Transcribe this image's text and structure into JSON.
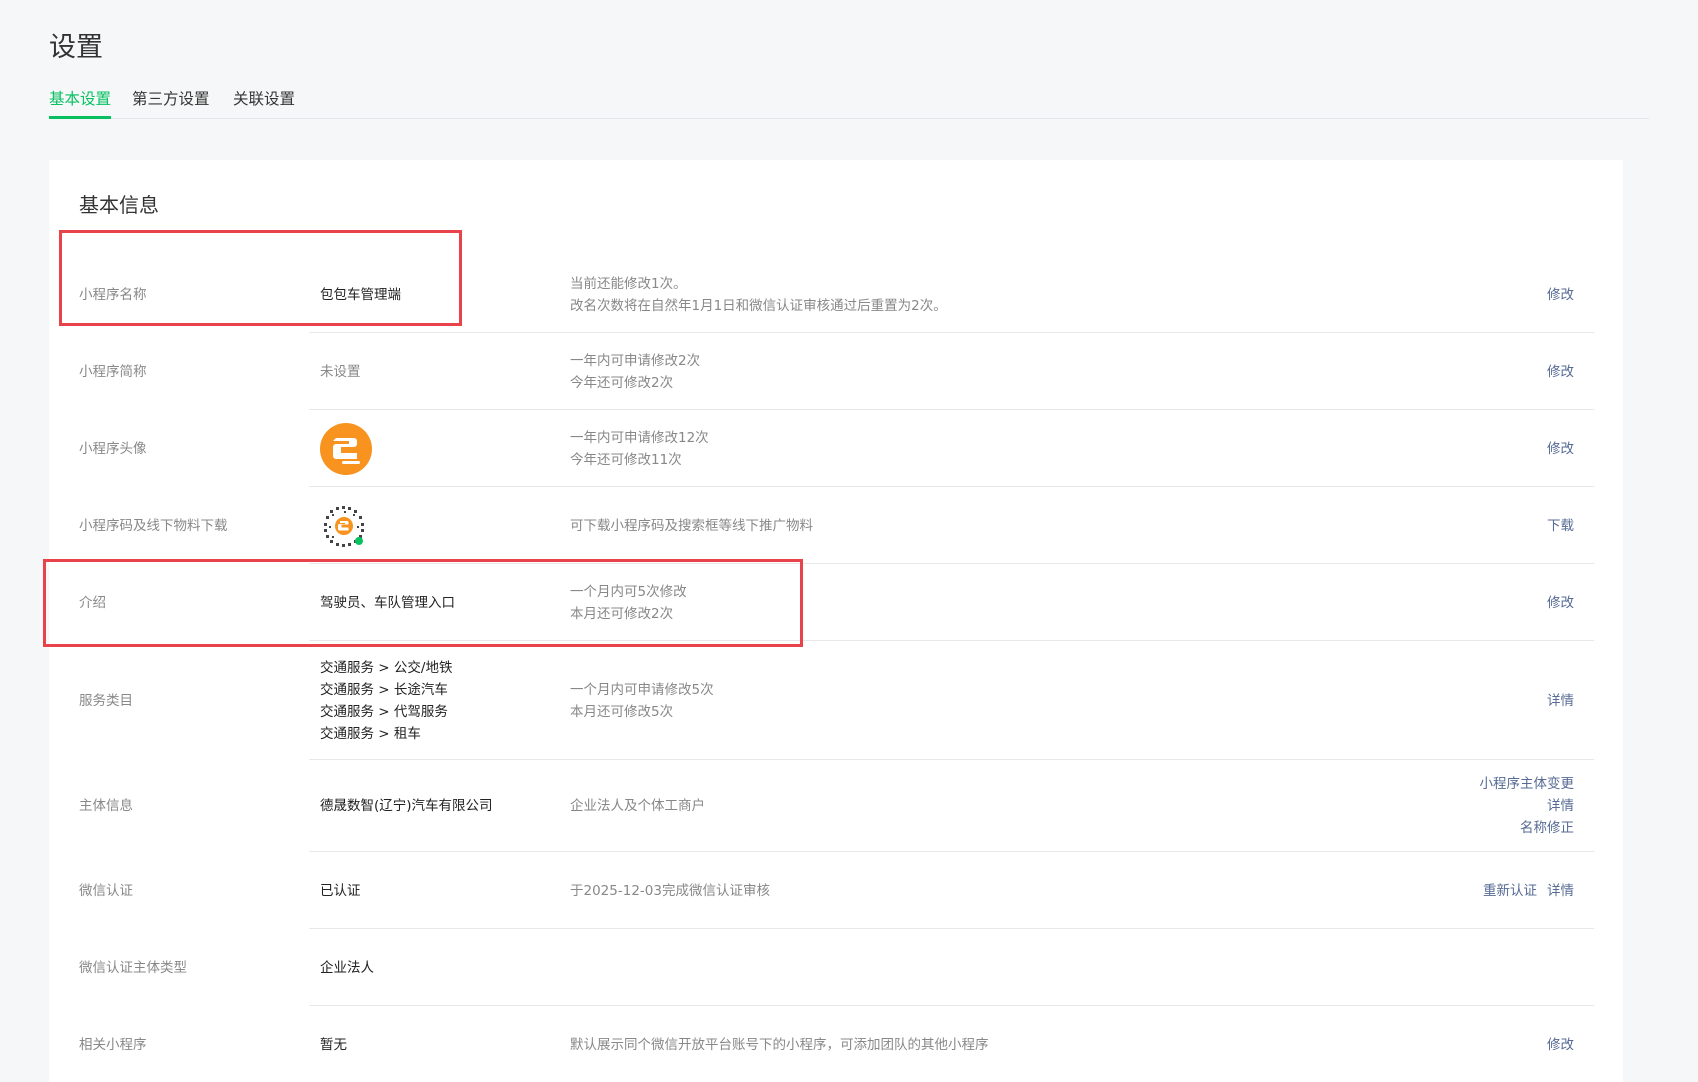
{
  "page_title": "设置",
  "tabs": [
    {
      "label": "基本设置",
      "active": true
    },
    {
      "label": "第三方设置",
      "active": false
    },
    {
      "label": "关联设置",
      "active": false
    }
  ],
  "section_title": "基本信息",
  "colors": {
    "accent": "#07c160",
    "link": "#576b95",
    "highlight": "#e8434a",
    "avatar_orange": "#f7931e"
  },
  "rows": [
    {
      "label": "小程序名称",
      "value": "包包车管理端",
      "desc": [
        "当前还能修改1次。",
        "改名次数将在自然年1月1日和微信认证审核通过后重置为2次。"
      ],
      "actions": [
        "修改"
      ]
    },
    {
      "label": "小程序简称",
      "value": "未设置",
      "desc": [
        "一年内可申请修改2次",
        "今年还可修改2次"
      ],
      "actions": [
        "修改"
      ]
    },
    {
      "label": "小程序头像",
      "value_icon": "app-avatar-icon",
      "desc": [
        "一年内可申请修改12次",
        "今年还可修改11次"
      ],
      "actions": [
        "修改"
      ]
    },
    {
      "label": "小程序码及线下物料下载",
      "value_icon": "mini-program-code-icon",
      "desc": [
        "可下载小程序码及搜索框等线下推广物料"
      ],
      "actions": [
        "下载"
      ]
    },
    {
      "label": "介绍",
      "value": "驾驶员、车队管理入口",
      "desc": [
        "一个月内可5次修改",
        "本月还可修改2次"
      ],
      "actions": [
        "修改"
      ]
    },
    {
      "label": "服务类目",
      "value_lines": [
        "交通服务 > 公交/地铁",
        "交通服务 > 长途汽车",
        "交通服务 > 代驾服务",
        "交通服务 > 租车"
      ],
      "desc": [
        "一个月内可申请修改5次",
        "本月还可修改5次"
      ],
      "actions": [
        "详情"
      ]
    },
    {
      "label": "主体信息",
      "value": "德晟数智(辽宁)汽车有限公司",
      "desc": [
        "企业法人及个体工商户"
      ],
      "actions": [
        "小程序主体变更",
        "详情",
        "名称修正"
      ]
    },
    {
      "label": "微信认证",
      "value": "已认证",
      "desc": [
        "于2025-12-03完成微信认证审核"
      ],
      "actions": [
        "重新认证",
        "详情"
      ]
    },
    {
      "label": "微信认证主体类型",
      "value": "企业法人",
      "desc": [],
      "actions": []
    },
    {
      "label": "相关小程序",
      "value": "暂无",
      "desc": [
        "默认展示同个微信开放平台账号下的小程序，可添加团队的其他小程序"
      ],
      "actions": [
        "修改"
      ]
    }
  ]
}
